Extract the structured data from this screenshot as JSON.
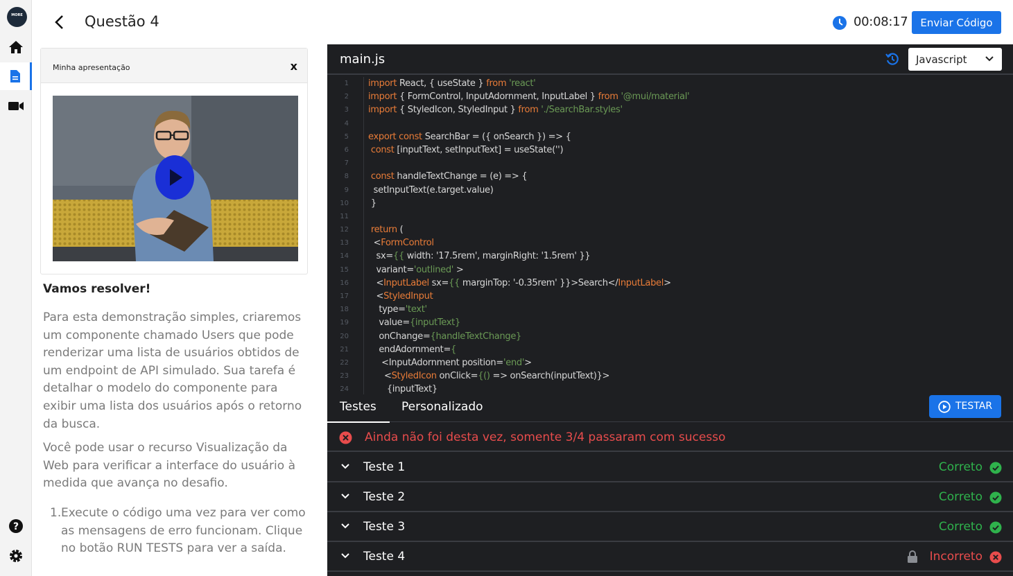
{
  "colors": {
    "accent": "#1a73e8",
    "editor_bg": "#1e1f22",
    "success": "#2fb24c",
    "error": "#e84c4c",
    "keyword": "#e97c38",
    "string": "#6a9955"
  },
  "rail": {
    "logo_text": "MORE",
    "items": [
      {
        "icon": "home-icon"
      },
      {
        "icon": "document-icon",
        "active": true
      },
      {
        "icon": "video-camera-icon"
      },
      {
        "icon": "help-icon"
      },
      {
        "icon": "gear-icon"
      }
    ]
  },
  "header": {
    "title": "Questão 4",
    "timer": "00:08:17",
    "submit_label": "Enviar Código"
  },
  "presentation": {
    "title": "Minha apresentação",
    "close_label": "x"
  },
  "instructions": {
    "heading": "Vamos resolver!",
    "paragraph1": "Para esta demonstração simples, criaremos um componente chamado Users que pode renderizar uma lista de usuários obtidos de um endpoint de API simulado. Sua tarefa é detalhar o modelo do componente para exibir uma lista dos usuários após o retorno da busca.",
    "paragraph2": "Você pode usar o recurso Visualização da Web para verificar a interface do usuário à medida que avança no desafio.",
    "steps": [
      {
        "num": "1.",
        "text": "Execute o código uma vez para ver como as mensagens de erro funcionam. Clique no botão RUN TESTS para ver a saída."
      }
    ]
  },
  "editor": {
    "filename": "main.js",
    "language": "Javascript",
    "line_numbers": [
      "1",
      "2",
      "3",
      "4",
      "5",
      "6",
      "7",
      "8",
      "9",
      "10",
      "11",
      "12",
      "13",
      "14",
      "15",
      "16",
      "17",
      "18",
      "19",
      "20",
      "21",
      "22",
      "23",
      "24"
    ],
    "lines": [
      [
        {
          "k": "kw",
          "t": "import"
        },
        {
          "t": " React, { useState } "
        },
        {
          "k": "kw",
          "t": "from"
        },
        {
          "k": "str",
          "t": " 'react'"
        }
      ],
      [
        {
          "k": "kw",
          "t": "import"
        },
        {
          "t": " { FormControl, InputAdornment, InputLabel } "
        },
        {
          "k": "kw",
          "t": "from"
        },
        {
          "k": "str",
          "t": " '@mui/material'"
        }
      ],
      [
        {
          "k": "kw",
          "t": "import"
        },
        {
          "t": " { StyledIcon, StyledInput } "
        },
        {
          "k": "kw",
          "t": "from"
        },
        {
          "k": "str",
          "t": " './SearchBar.styles'"
        }
      ],
      [],
      [
        {
          "k": "kw",
          "t": "export const"
        },
        {
          "t": " SearchBar = ({ onSearch }) => {"
        }
      ],
      [
        {
          "t": " "
        },
        {
          "k": "kw",
          "t": "const"
        },
        {
          "t": " [inputText, setInputText] = useState('')"
        }
      ],
      [],
      [
        {
          "t": " "
        },
        {
          "k": "kw",
          "t": "const"
        },
        {
          "t": " handleTextChange = (e) => {"
        }
      ],
      [
        {
          "t": "  setInputText(e.target.value)"
        }
      ],
      [
        {
          "t": " }"
        }
      ],
      [],
      [
        {
          "t": " "
        },
        {
          "k": "kw",
          "t": "return"
        },
        {
          "t": " ("
        }
      ],
      [
        {
          "t": "  <"
        },
        {
          "k": "tag",
          "t": "FormControl"
        }
      ],
      [
        {
          "t": "   sx="
        },
        {
          "k": "str",
          "t": "{{"
        },
        {
          "t": " width: '17.5rem', marginRight: '1.5rem' }}"
        }
      ],
      [
        {
          "t": "   variant="
        },
        {
          "k": "str",
          "t": "'outlined'"
        },
        {
          "t": " >"
        }
      ],
      [
        {
          "t": "   <"
        },
        {
          "k": "tag",
          "t": "InputLabel"
        },
        {
          "t": " sx="
        },
        {
          "k": "str",
          "t": "{{"
        },
        {
          "t": " marginTop: '-0.35rem' }}>Search</"
        },
        {
          "k": "tag",
          "t": "InputLabel"
        },
        {
          "t": ">"
        }
      ],
      [
        {
          "t": "   <"
        },
        {
          "k": "tag",
          "t": "StyledInput"
        }
      ],
      [
        {
          "t": "    type="
        },
        {
          "k": "str",
          "t": "'text'"
        }
      ],
      [
        {
          "t": "    value="
        },
        {
          "k": "str",
          "t": "{inputText}"
        }
      ],
      [
        {
          "t": "    onChange="
        },
        {
          "k": "str",
          "t": "{handleTextChange}"
        }
      ],
      [
        {
          "t": "    endAdornment="
        },
        {
          "k": "str",
          "t": "{"
        }
      ],
      [
        {
          "t": "     <InputAdornment position="
        },
        {
          "k": "str",
          "t": "'end'"
        },
        {
          "t": ">"
        }
      ],
      [
        {
          "t": "      <"
        },
        {
          "k": "tag",
          "t": "StyledIcon"
        },
        {
          "t": " onClick="
        },
        {
          "k": "str",
          "t": "{()"
        },
        {
          "t": " => onSearch(inputText)}>"
        }
      ],
      [
        {
          "t": "       {inputText}"
        }
      ]
    ]
  },
  "tests_panel": {
    "tabs": [
      "Testes",
      "Personalizado"
    ],
    "run_label": "TESTAR",
    "summary": "Ainda não foi desta vez, somente 3/4 passaram com sucesso",
    "tests": [
      {
        "name": "Teste 1",
        "status": "Correto",
        "passed": true,
        "locked": false
      },
      {
        "name": "Teste 2",
        "status": "Correto",
        "passed": true,
        "locked": false
      },
      {
        "name": "Teste 3",
        "status": "Correto",
        "passed": true,
        "locked": false
      },
      {
        "name": "Teste 4",
        "status": "Incorreto",
        "passed": false,
        "locked": true
      }
    ]
  }
}
